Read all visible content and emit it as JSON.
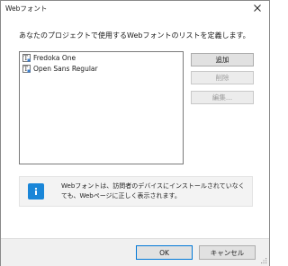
{
  "window": {
    "title": "Webフォント"
  },
  "instruction": "あなたのプロジェクトで使用するWebフォントのリストを定義します。",
  "font_list": {
    "items": [
      {
        "label": "Fredoka One",
        "icon": "font-file-icon"
      },
      {
        "label": "Open Sans Regular",
        "icon": "font-file-icon"
      }
    ]
  },
  "buttons": {
    "add": "追加",
    "delete": "削除",
    "edit": "編集..."
  },
  "info": {
    "icon": "info-icon",
    "text": "Webフォントは、訪問者のデバイスにインストールされていなくても、Webページに正しく表示されます。"
  },
  "footer": {
    "ok": "OK",
    "cancel": "キャンセル"
  },
  "colors": {
    "info_icon": "#1a86d8",
    "default_button_border": "#0078d7"
  }
}
